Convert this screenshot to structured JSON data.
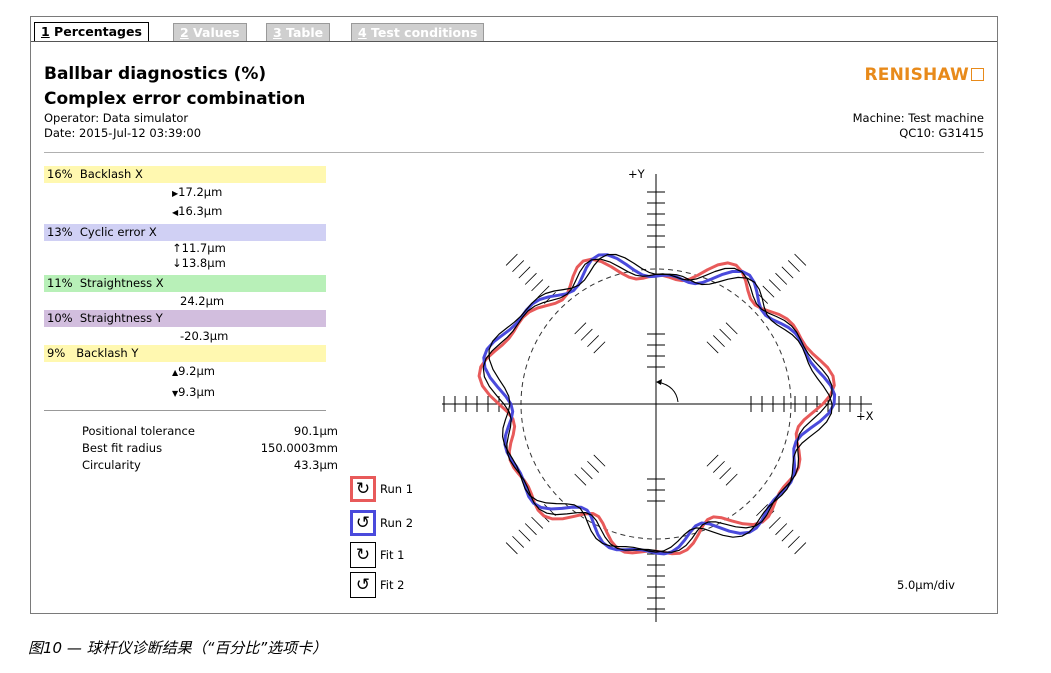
{
  "tabs": [
    {
      "num": "1",
      "label": " Percentages"
    },
    {
      "num": "2",
      "label": " Values"
    },
    {
      "num": "3",
      "label": " Table"
    },
    {
      "num": "4",
      "label": " Test conditions"
    }
  ],
  "header": {
    "title": "Ballbar diagnostics (%)",
    "subtitle": "Complex error combination",
    "operator": "Operator: Data simulator",
    "date": "Date: 2015-Jul-12 03:39:00",
    "machine": "Machine: Test machine",
    "qc10": "QC10: G31415",
    "logo": "RENISHAW"
  },
  "colors": {
    "backlash": "#fff8b0",
    "cyclic": "#d0d0f4",
    "straight_x": "#b8f0b8",
    "straight_y": "#d2bede",
    "run1": "#e85a5a",
    "run2": "#4a4adc",
    "logo": "#e88a1a"
  },
  "diagnostics": [
    {
      "pct": "16%",
      "name": "Backlash X",
      "values": [
        "17.2µm",
        "16.3µm"
      ],
      "icons": [
        "right-triangle-icon",
        "left-triangle-icon"
      ]
    },
    {
      "pct": "13%",
      "name": "Cyclic error X",
      "values": [
        "11.7µm",
        "13.8µm"
      ],
      "icons": [
        "up-arrow-icon",
        "down-arrow-icon"
      ]
    },
    {
      "pct": "11%",
      "name": "Straightness X",
      "values": [
        "24.2µm"
      ]
    },
    {
      "pct": "10%",
      "name": "Straightness Y",
      "values": [
        "-20.3µm"
      ]
    },
    {
      "pct": "9%",
      "name": "Backlash Y",
      "values": [
        "9.2µm",
        "9.3µm"
      ],
      "icons": [
        "up-triangle-icon",
        "down-triangle-icon"
      ]
    }
  ],
  "stats": [
    {
      "label": "Positional tolerance",
      "value": "90.1µm"
    },
    {
      "label": "Best fit radius",
      "value": "150.0003mm"
    },
    {
      "label": "Circularity",
      "value": "43.3µm"
    }
  ],
  "legend": [
    {
      "label": "Run 1",
      "icon": "clockwise-icon"
    },
    {
      "label": "Run 2",
      "icon": "counterclockwise-icon"
    },
    {
      "label": "Fit 1",
      "icon": "clockwise-icon"
    },
    {
      "label": "Fit 2",
      "icon": "counterclockwise-icon"
    }
  ],
  "plot": {
    "plus_y": "+Y",
    "plus_x": "+X",
    "scale": "5.0µm/div"
  },
  "caption": "图10 — 球杆仪诊断结果（“百分比”选项卡）"
}
